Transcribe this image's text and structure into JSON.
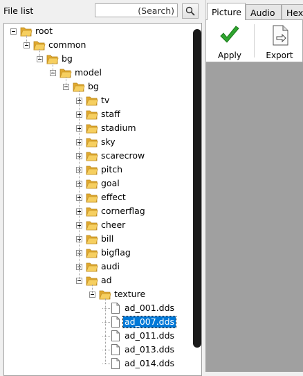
{
  "panel": {
    "title": "File list"
  },
  "search": {
    "placeholder": "(Search)"
  },
  "tree": [
    {
      "label": "root",
      "depth": 0,
      "type": "folder",
      "toggle": "minus"
    },
    {
      "label": "common",
      "depth": 1,
      "type": "folder",
      "toggle": "minus"
    },
    {
      "label": "bg",
      "depth": 2,
      "type": "folder",
      "toggle": "minus"
    },
    {
      "label": "model",
      "depth": 3,
      "type": "folder",
      "toggle": "minus"
    },
    {
      "label": "bg",
      "depth": 4,
      "type": "folder",
      "toggle": "minus"
    },
    {
      "label": "tv",
      "depth": 5,
      "type": "folder",
      "toggle": "plus"
    },
    {
      "label": "staff",
      "depth": 5,
      "type": "folder",
      "toggle": "plus"
    },
    {
      "label": "stadium",
      "depth": 5,
      "type": "folder",
      "toggle": "plus"
    },
    {
      "label": "sky",
      "depth": 5,
      "type": "folder",
      "toggle": "plus"
    },
    {
      "label": "scarecrow",
      "depth": 5,
      "type": "folder",
      "toggle": "plus"
    },
    {
      "label": "pitch",
      "depth": 5,
      "type": "folder",
      "toggle": "plus"
    },
    {
      "label": "goal",
      "depth": 5,
      "type": "folder",
      "toggle": "plus"
    },
    {
      "label": "effect",
      "depth": 5,
      "type": "folder",
      "toggle": "plus"
    },
    {
      "label": "cornerflag",
      "depth": 5,
      "type": "folder",
      "toggle": "plus"
    },
    {
      "label": "cheer",
      "depth": 5,
      "type": "folder",
      "toggle": "plus"
    },
    {
      "label": "bill",
      "depth": 5,
      "type": "folder",
      "toggle": "plus"
    },
    {
      "label": "bigflag",
      "depth": 5,
      "type": "folder",
      "toggle": "plus"
    },
    {
      "label": "audi",
      "depth": 5,
      "type": "folder",
      "toggle": "plus"
    },
    {
      "label": "ad",
      "depth": 5,
      "type": "folder",
      "toggle": "minus"
    },
    {
      "label": "texture",
      "depth": 6,
      "type": "folder",
      "toggle": "minus"
    },
    {
      "label": "ad_001.dds",
      "depth": 7,
      "type": "file"
    },
    {
      "label": "ad_007.dds",
      "depth": 7,
      "type": "file",
      "selected": true
    },
    {
      "label": "ad_011.dds",
      "depth": 7,
      "type": "file"
    },
    {
      "label": "ad_013.dds",
      "depth": 7,
      "type": "file"
    },
    {
      "label": "ad_014.dds",
      "depth": 7,
      "type": "file"
    }
  ],
  "tabs": [
    {
      "label": "Picture",
      "active": true
    },
    {
      "label": "Audio",
      "active": false
    },
    {
      "label": "Hex",
      "active": false
    }
  ],
  "toolbar": {
    "apply_label": "Apply",
    "export_label": "Export"
  },
  "colors": {
    "folder": "#f2c14e",
    "selection": "#0078d7",
    "apply_check": "#2fa52f",
    "content_bg": "#a0a0a0"
  }
}
